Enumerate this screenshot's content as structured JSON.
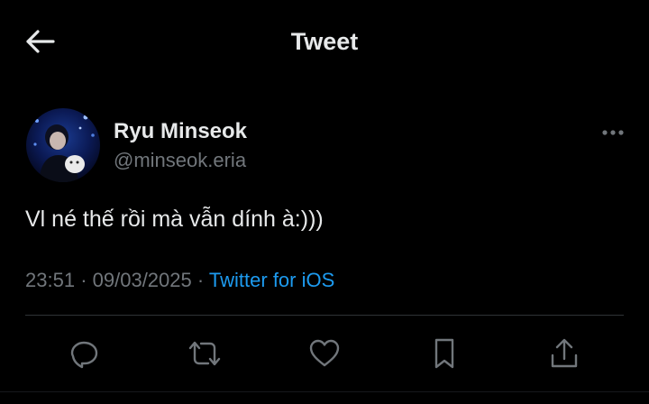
{
  "header": {
    "title": "Tweet",
    "back_icon": "arrow-left-icon"
  },
  "tweet": {
    "author": {
      "display_name": "Ryu Minseok",
      "handle": "@minseok.eria",
      "avatar_icon": "avatar-photo"
    },
    "more_icon": "more-dots-icon",
    "text": "Vl né thế rồi mà vẫn dính à:)))",
    "time": "23:51",
    "date": "09/03/2025",
    "separator": "·",
    "source": "Twitter for iOS"
  },
  "actions": [
    {
      "name": "reply",
      "icon": "reply-icon"
    },
    {
      "name": "retweet",
      "icon": "retweet-icon"
    },
    {
      "name": "like",
      "icon": "heart-icon"
    },
    {
      "name": "bookmark",
      "icon": "bookmark-icon"
    },
    {
      "name": "share",
      "icon": "share-icon"
    }
  ],
  "colors": {
    "background": "#000000",
    "text_primary": "#e7e9ea",
    "text_secondary": "#71767b",
    "link": "#1d9bf0",
    "divider": "#2f3336"
  }
}
